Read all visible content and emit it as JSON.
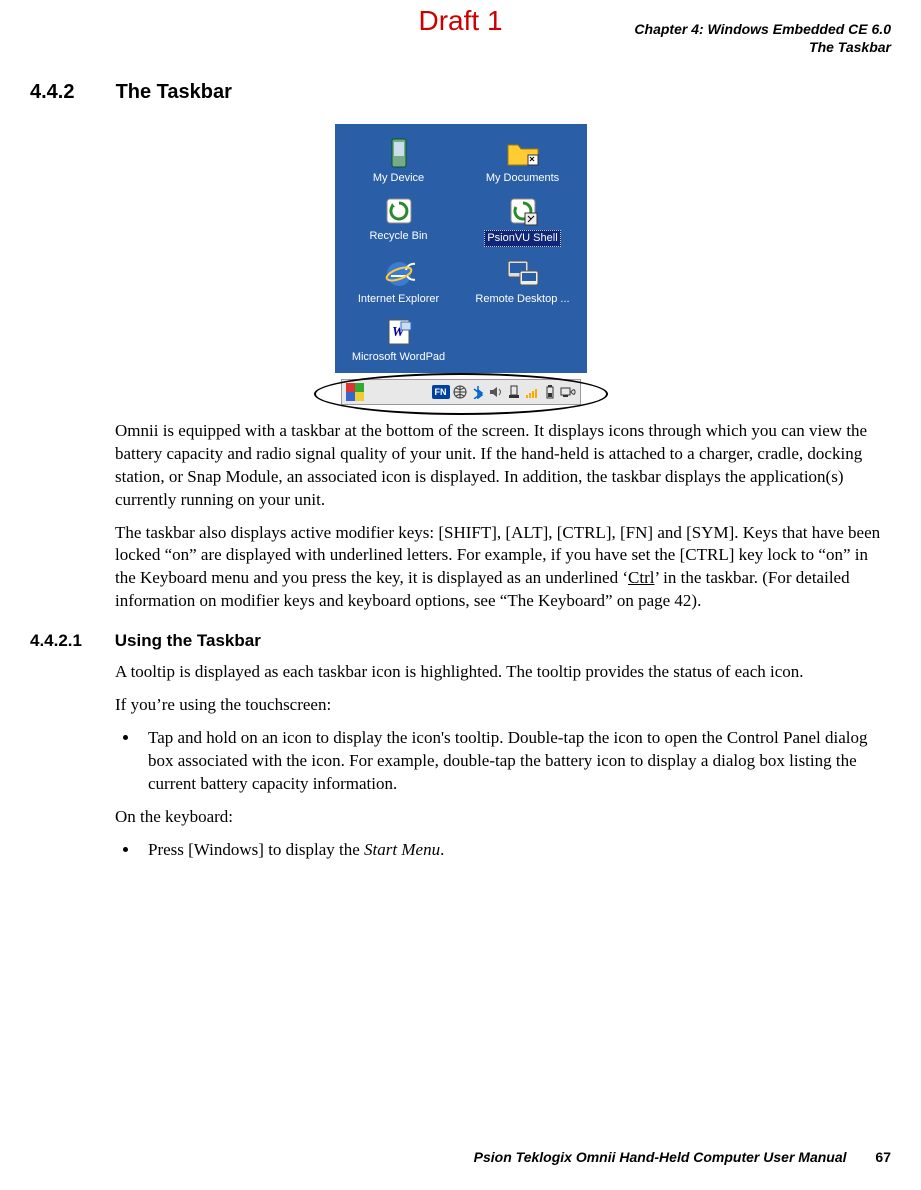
{
  "watermark": "Draft 1",
  "header": {
    "chapter": "Chapter 4:  Windows Embedded CE 6.0",
    "section": "The Taskbar"
  },
  "section": {
    "number": "4.4.2",
    "title": "The Taskbar"
  },
  "screenshot": {
    "desktop_icons": [
      {
        "label": "My Device"
      },
      {
        "label": "My Documents"
      },
      {
        "label": "Recycle Bin"
      },
      {
        "label": "PsionVU Shell"
      },
      {
        "label": "Internet Explorer"
      },
      {
        "label": "Remote Desktop ..."
      },
      {
        "label": "Microsoft WordPad"
      }
    ],
    "taskbar": {
      "fn_label": "FN",
      "tray_icons": [
        "start",
        "fn",
        "network",
        "bluetooth",
        "volume",
        "dock",
        "signal",
        "battery",
        "pc-connection"
      ]
    }
  },
  "body": {
    "p1": "Omnii is equipped with a taskbar at the bottom of the screen. It displays icons through which you can view the battery capacity and radio signal quality of your unit. If the hand-held is attached to a charger, cradle, docking station, or Snap Module, an associated icon is displayed. In addition, the taskbar displays the application(s) currently running on your unit.",
    "p2a": "The taskbar also displays active modifier keys: [SHIFT], [ALT], [CTRL], [FN] and [SYM]. Keys that have been locked “on” are displayed with underlined letters. For example, if you have set the [CTRL] key lock to “on” in the Keyboard menu and you press the key, it is displayed as an underlined ‘",
    "p2_underlined": "Ctrl",
    "p2b": "’ in the taskbar. (For detailed information on modifier keys and keyboard options, see “The Keyboard” on page 42).",
    "p3": "A tooltip is displayed as each taskbar icon is highlighted. The tooltip provides the status of each icon.",
    "p4": "If you’re using the touchscreen:",
    "bullets1": [
      "Tap and hold on an icon to display the icon's tooltip. Double-tap the icon to open the Control Panel dialog box associated with the icon. For example, double-tap the battery icon to display a dialog box listing the current battery capacity information."
    ],
    "p5": "On the keyboard:",
    "bullets2": [
      {
        "pre": "Press [Windows] to display the ",
        "italic": "Start Menu",
        "post": "."
      }
    ]
  },
  "subsection": {
    "number": "4.4.2.1",
    "title": "Using the Taskbar"
  },
  "footer": {
    "title": "Psion Teklogix Omnii Hand-Held Computer User Manual",
    "page": "67"
  }
}
